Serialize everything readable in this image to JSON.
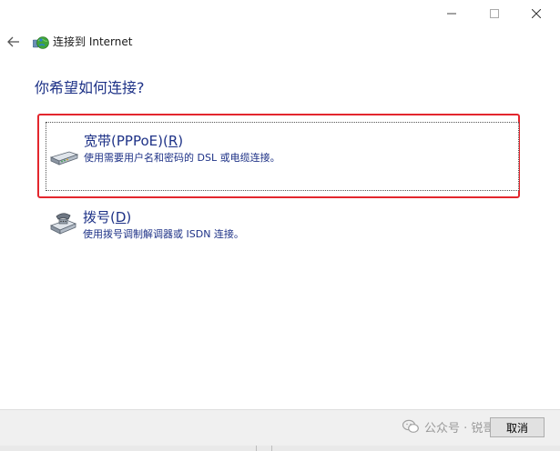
{
  "window": {
    "controls": {
      "minimize_icon": "minimize-icon",
      "maximize_icon": "maximize-icon",
      "close_icon": "close-icon"
    }
  },
  "header": {
    "back_icon": "back-arrow-icon",
    "wizard_icon": "network-globe-icon",
    "title": "连接到 Internet"
  },
  "main": {
    "question": "你希望如何连接?",
    "options": [
      {
        "title_text": "宽带(PPPoE)(",
        "accelerator": "R",
        "title_close": ")",
        "description": "使用需要用户名和密码的 DSL 或电缆连接。",
        "icon": "broadband-modem-icon",
        "focused": true
      },
      {
        "title_text": "拨号(",
        "accelerator": "D",
        "title_close": ")",
        "description": "使用拨号调制解调器或 ISDN 连接。",
        "icon": "dialup-modem-phone-icon",
        "focused": false
      }
    ]
  },
  "footer": {
    "watermark_text": "公众号 · 锐哥",
    "cancel_label": "取消"
  },
  "colors": {
    "accent_text": "#1e3287",
    "highlight_border": "#e3262d",
    "footer_bg": "#f0f0f0"
  }
}
